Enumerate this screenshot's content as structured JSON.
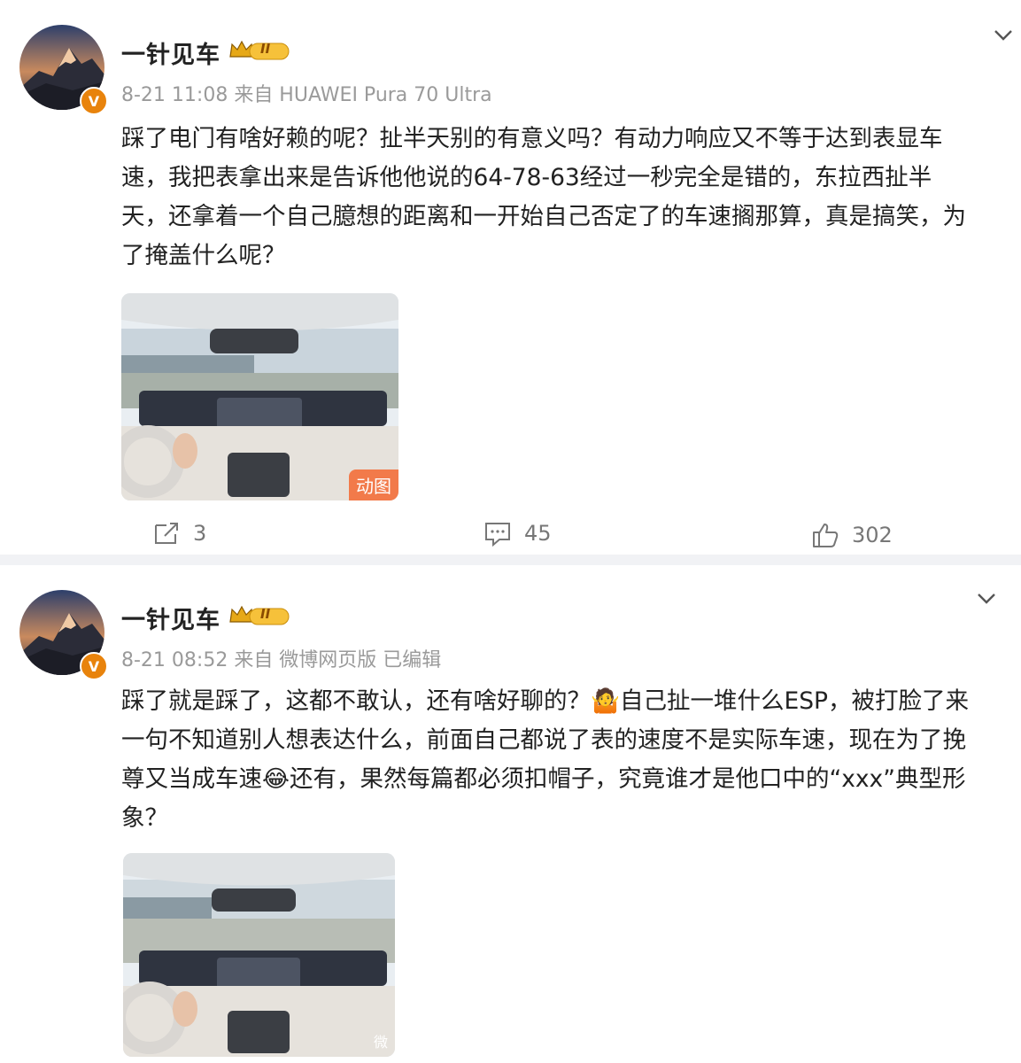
{
  "posts": [
    {
      "author": "一针见车",
      "level_badge": "II",
      "meta": "8-21 11:08 来自 HUAWEI Pura 70 Ultra",
      "text_lines": [
        "踩了电门有啥好赖的呢？扯半天别的有意义吗？有动力响应又不等于达到表显车",
        "速，我把表拿出来是告诉他他说的64-78-63经过一秒完全是错的，东拉西扯半",
        "天，还拿着一个自己臆想的距离和一开始自己否定了的车速搁那算，真是搞笑，为",
        "了掩盖什么呢？"
      ],
      "media_badge": "动图",
      "reposts": "3",
      "comments": "45",
      "likes": "302"
    },
    {
      "author": "一针见车",
      "level_badge": "II",
      "meta": "8-21 08:52 来自 微博网页版 已编辑",
      "text_lines": [
        "踩了就是踩了，这都不敢认，还有啥好聊的？🤷自己扯一堆什么ESP，被打脸了来",
        "一句不知道别人想表达什么，前面自己都说了表的速度不是实际车速，现在为了挽",
        "尊又当成车速😂还有，果然每篇都必须扣帽子，究竟谁才是他口中的“xxx”典型形",
        "象？"
      ],
      "watermark": "微"
    }
  ],
  "colors": {
    "accent_orange": "#e8830c",
    "meta_gray": "#9a9a9a",
    "divider": "#f1f2f5"
  },
  "icons": [
    "chevron-down-icon",
    "repost-icon",
    "comment-icon",
    "like-icon",
    "verified-v-icon",
    "crown-level-icon"
  ]
}
